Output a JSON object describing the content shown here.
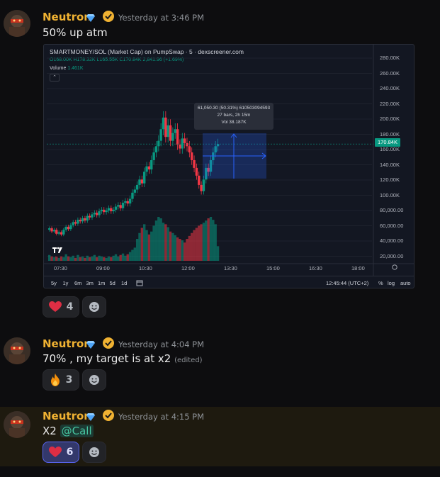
{
  "messages": [
    {
      "username": "Neutron",
      "timestamp": "Yesterday at 3:46 PM",
      "text": "50% up atm",
      "reactions": [
        {
          "emoji_name": "heart-icon",
          "count": "4",
          "active": false
        }
      ]
    },
    {
      "username": "Neutron",
      "timestamp": "Yesterday at 4:04 PM",
      "text": "70% ,  my target is at x2",
      "edited_label": "(edited)",
      "reactions": [
        {
          "emoji_name": "fire-icon",
          "count": "3",
          "active": false
        }
      ]
    },
    {
      "username": "Neutron",
      "timestamp": "Yesterday at 4:15 PM",
      "text": "X2",
      "mention": "@Call",
      "reactions": [
        {
          "emoji_name": "heart-icon",
          "count": "6",
          "active": true
        }
      ]
    }
  ],
  "chart": {
    "header": "SMARTMONEY/SOL (Market Cap) on PumpSwap · 5 · dexscreener.com",
    "ohlc": "O168.00K H178.32K L165.55K C170.84K 2,841.96 (+1.69%)",
    "volume_label": "Volume",
    "volume_value": "1.461K",
    "tooltip_line1": "61,050.30 (50.31%) 610503094593",
    "tooltip_line2": "27 bars, 2h 15m",
    "tooltip_line3": "Vol 38.187K",
    "last_price_label": "170.84K",
    "price_ticks": [
      "280.00K",
      "260.00K",
      "240.00K",
      "220.00K",
      "200.00K",
      "180.00K",
      "160.00K",
      "140.00K",
      "120.00K",
      "100.00K",
      "80,000.00",
      "60,000.00",
      "40,000.00",
      "20,000.00"
    ],
    "time_ticks": [
      "07:30",
      "09:00",
      "10:30",
      "12:00",
      "13:30",
      "15:00",
      "16:30",
      "18:00"
    ],
    "timeframes": [
      "5y",
      "1y",
      "6m",
      "3m",
      "1m",
      "5d",
      "1d"
    ],
    "clock": "12:45:44 (UTC+2)",
    "percent_label": "%",
    "log_label": "log",
    "auto_label": "auto",
    "colors": {
      "up": "#089981",
      "down": "#f23645",
      "bg": "#131722",
      "selection": "#2962ff"
    }
  },
  "chart_data": {
    "type": "candlestick",
    "title": "SMARTMONEY/SOL (Market Cap) on PumpSwap · 5 · dexscreener.com",
    "ylim": [
      20000,
      290000
    ],
    "x_range": [
      "07:00",
      "18:30"
    ],
    "last_close": 170840,
    "series": [
      {
        "name": "price",
        "values": [
          62000,
          58000,
          60000,
          55000,
          57000,
          54000,
          60000,
          64000,
          61000,
          66000,
          70000,
          68000,
          73000,
          71000,
          75000,
          72000,
          78000,
          76000,
          80000,
          82000,
          79000,
          84000,
          86000,
          83000,
          85000,
          88000,
          84000,
          86000,
          90000,
          92000,
          88000,
          95000,
          97000,
          94000,
          100000,
          108000,
          112000,
          118000,
          125000,
          120000,
          135000,
          142000,
          138000,
          150000,
          160000,
          168000,
          175000,
          190000,
          205000,
          180000,
          195000,
          175000,
          185000,
          190000,
          170000,
          165000,
          178000,
          172000,
          168000,
          160000,
          150000,
          140000,
          130000,
          118000,
          110000,
          125000,
          140000,
          135000,
          150000,
          160000,
          168000,
          170840
        ]
      },
      {
        "name": "Volume",
        "values": [
          8000,
          6000,
          5000,
          7000,
          4000,
          6000,
          5000,
          9000,
          6000,
          5000,
          7000,
          4000,
          8000,
          5000,
          6000,
          4000,
          7000,
          5000,
          6000,
          8000,
          5000,
          7000,
          6000,
          5000,
          4000,
          6000,
          5000,
          7000,
          9000,
          6000,
          8000,
          10000,
          7000,
          9000,
          12000,
          15000,
          18000,
          30000,
          38000,
          45000,
          50000,
          42000,
          36000,
          40000,
          48000,
          55000,
          60000,
          58000,
          52000,
          50000,
          46000,
          40000,
          38000,
          35000,
          32000,
          30000,
          28000,
          25000,
          30000,
          34000,
          38000,
          42000,
          45000,
          48000,
          50000,
          52000,
          55000,
          58000,
          60000,
          56000,
          50000,
          20000
        ]
      }
    ]
  }
}
